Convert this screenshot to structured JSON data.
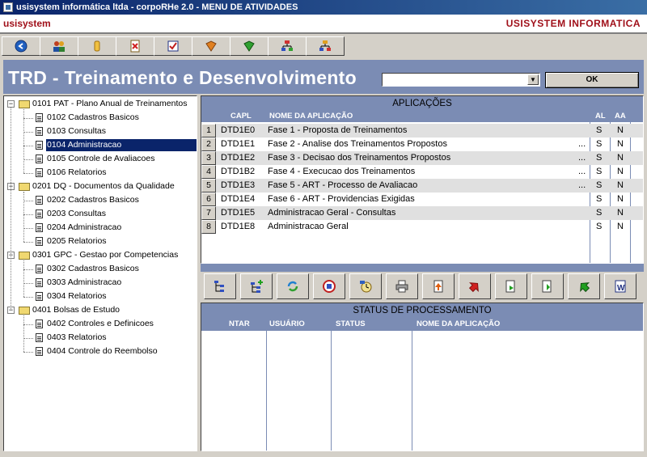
{
  "window": {
    "title": "usisystem informática ltda - corpoRHe 2.0 - MENU DE ATIVIDADES"
  },
  "brand": {
    "left": "usisystem",
    "right": "USISYSTEM INFORMATICA"
  },
  "toolbar": {
    "icons": [
      "back-icon",
      "users-icon",
      "hand-icon",
      "cancel-doc-icon",
      "checklist-icon",
      "book-icon",
      "green-book-icon",
      "org-chart-icon",
      "network-icon"
    ]
  },
  "header": {
    "title": "TRD - Treinamento e Desenvolvimento",
    "combo_value": "",
    "ok_label": "OK"
  },
  "tree": {
    "nodes": [
      {
        "label": "0101 PAT - Plano Anual de Treinamentos",
        "level": 0
      },
      {
        "label": "0102 Cadastros Basicos",
        "level": 1
      },
      {
        "label": "0103 Consultas",
        "level": 1
      },
      {
        "label": "0104 Administracao",
        "level": 1,
        "selected": true
      },
      {
        "label": "0105 Controle de Avaliacoes",
        "level": 1
      },
      {
        "label": "0106 Relatorios",
        "level": 1
      },
      {
        "label": "0201 DQ - Documentos da Qualidade",
        "level": 0
      },
      {
        "label": "0202 Cadastros Basicos",
        "level": 1
      },
      {
        "label": "0203 Consultas",
        "level": 1
      },
      {
        "label": "0204 Administracao",
        "level": 1
      },
      {
        "label": "0205 Relatorios",
        "level": 1
      },
      {
        "label": "0301 GPC - Gestao por Competencias",
        "level": 0
      },
      {
        "label": "0302 Cadastros Basicos",
        "level": 1
      },
      {
        "label": "0303 Administracao",
        "level": 1
      },
      {
        "label": "0304 Relatorios",
        "level": 1
      },
      {
        "label": "0401 Bolsas de Estudo",
        "level": 0
      },
      {
        "label": "0402 Controles e Definicoes",
        "level": 1
      },
      {
        "label": "0403 Relatorios",
        "level": 1
      },
      {
        "label": "0404 Controle do Reembolso",
        "level": 1
      }
    ]
  },
  "applications": {
    "title": "APLICAÇÕES",
    "columns": {
      "capl": "CAPL",
      "nome": "NOME DA APLICAÇÃO",
      "al": "AL",
      "aa": "AA"
    },
    "rows": [
      {
        "num": "1",
        "capl": "DTD1E0",
        "nome": "Fase 1 - Proposta de Treinamentos",
        "more": "",
        "al": "S",
        "aa": "N"
      },
      {
        "num": "2",
        "capl": "DTD1E1",
        "nome": "Fase 2 - Analise dos Treinamentos Propostos",
        "more": "...",
        "al": "S",
        "aa": "N"
      },
      {
        "num": "3",
        "capl": "DTD1E2",
        "nome": "Fase 3 - Decisao dos Treinamentos Propostos",
        "more": "...",
        "al": "S",
        "aa": "N"
      },
      {
        "num": "4",
        "capl": "DTD1B2",
        "nome": "Fase 4 - Execucao dos Treinamentos",
        "more": "...",
        "al": "S",
        "aa": "N"
      },
      {
        "num": "5",
        "capl": "DTD1E3",
        "nome": "Fase 5 - ART - Processo de Avaliacao",
        "more": "...",
        "al": "S",
        "aa": "N"
      },
      {
        "num": "6",
        "capl": "DTD1E4",
        "nome": "Fase 6 - ART - Providencias Exigidas",
        "more": "",
        "al": "S",
        "aa": "N"
      },
      {
        "num": "7",
        "capl": "DTD1E5",
        "nome": "Administracao Geral - Consultas",
        "more": "",
        "al": "S",
        "aa": "N"
      },
      {
        "num": "8",
        "capl": "DTD1E8",
        "nome": "Administracao Geral",
        "more": "",
        "al": "S",
        "aa": "N"
      }
    ]
  },
  "action_toolbar": {
    "icons": [
      "tree-icon",
      "tree-add-icon",
      "refresh-icon",
      "org-chart-icon",
      "clock-icon",
      "printer-icon",
      "upload-icon",
      "red-arrow-icon",
      "export-icon",
      "import-icon",
      "green-arrow-icon",
      "word-icon"
    ]
  },
  "status": {
    "title": "STATUS DE PROCESSAMENTO",
    "columns": {
      "ntar": "NTAR",
      "usuario": "USUÁRIO",
      "status": "STATUS",
      "nome": "NOME DA APLICAÇÃO"
    }
  },
  "colors": {
    "header_bg": "#7b8cb4",
    "brand_red": "#a0101a",
    "title_bar": "#0a246a"
  }
}
